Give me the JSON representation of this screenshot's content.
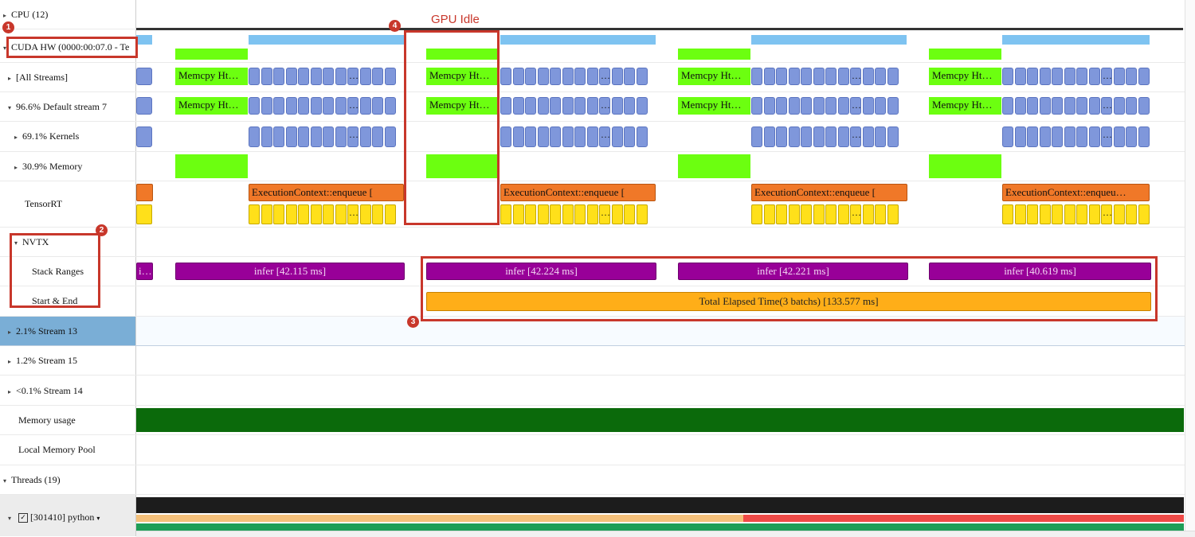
{
  "rows": {
    "cpu": "CPU (12)",
    "cuda_hw": "CUDA HW (0000:00:07.0 - Te",
    "all_streams": "[All Streams]",
    "default_stream": "96.6% Default stream 7",
    "kernels": "69.1% Kernels",
    "memory": "30.9% Memory",
    "tensorrt": "TensorRT",
    "nvtx": "NVTX",
    "stack_ranges": "Stack Ranges",
    "start_end": "Start & End",
    "stream13": "2.1% Stream 13",
    "stream15": "1.2% Stream 15",
    "stream14": "<0.1% Stream 14",
    "memory_usage": "Memory usage",
    "local_memory_pool": "Local Memory Pool",
    "threads": "Threads (19)",
    "python_thread": "[301410] python"
  },
  "timeline": {
    "memcpy_label": "Memcpy Ht…",
    "enqueue_label_full": "ExecutionContext::enqueue [",
    "enqueue_label_short": "ExecutionContext::enqueu…",
    "dots": "…",
    "infer": [
      "infer [42.115 ms]",
      "infer [42.224 ms]",
      "infer [42.221 ms]",
      "infer [40.619 ms]"
    ],
    "total_elapsed": "Total Elapsed Time(3 batchs) [133.577 ms]",
    "purple_small": "i…",
    "gpu_idle": "GPU Idle"
  },
  "annotations": {
    "badge1": "1",
    "badge2": "2",
    "badge3": "3",
    "badge4": "4"
  },
  "colors": {
    "selected_row": "#7aaed6",
    "annotation": "#c8372b",
    "memory_usage": "#0b6a0b"
  }
}
